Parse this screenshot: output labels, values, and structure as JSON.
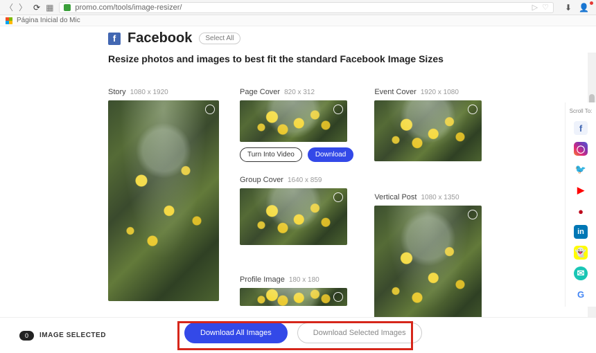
{
  "browser": {
    "url": "promo.com/tools/image-resizer/",
    "bookmark": "Página Inicial do Mic"
  },
  "section": {
    "platform": "Facebook",
    "select_all": "Select All",
    "subtitle": "Resize photos and images to best fit the standard Facebook Image Sizes"
  },
  "items": {
    "story": {
      "title": "Story",
      "dim": "1080 x 1920"
    },
    "page_cover": {
      "title": "Page Cover",
      "dim": "820 x 312"
    },
    "group_cover": {
      "title": "Group Cover",
      "dim": "1640 x 859"
    },
    "profile_image": {
      "title": "Profile Image",
      "dim": "180 x 180"
    },
    "event_cover": {
      "title": "Event Cover",
      "dim": "1920 x 1080"
    },
    "vertical_post": {
      "title": "Vertical Post",
      "dim": "1080 x 1350"
    }
  },
  "page_cover_actions": {
    "turn_into_video": "Turn Into Video",
    "download": "Download"
  },
  "scroll_panel": {
    "title": "Scroll To:"
  },
  "bottom": {
    "count": "0",
    "label": "IMAGE SELECTED",
    "download_all": "Download All Images",
    "download_selected": "Download Selected Images"
  }
}
